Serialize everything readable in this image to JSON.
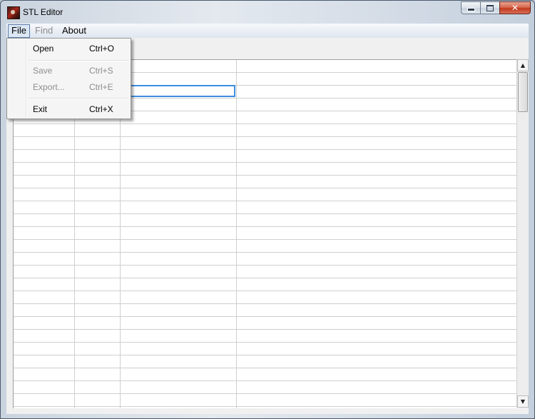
{
  "window": {
    "title": "STL Editor",
    "minimize_symbol": "",
    "maximize_symbol": "",
    "close_symbol": "✕"
  },
  "menubar": {
    "file": "File",
    "find": "Find",
    "about": "About"
  },
  "file_menu": {
    "items": [
      {
        "label": "Open",
        "shortcut": "Ctrl+O",
        "enabled": true
      },
      {
        "label": "Save",
        "shortcut": "Ctrl+S",
        "enabled": false
      },
      {
        "label": "Export...",
        "shortcut": "Ctrl+E",
        "enabled": false
      },
      {
        "label": "Exit",
        "shortcut": "Ctrl+X",
        "enabled": true
      }
    ]
  },
  "scrollbar": {
    "up_arrow": "▲",
    "down_arrow": "▼"
  },
  "colors": {
    "selection_border": "#3e8fe0",
    "grid_line": "#cfcfcf",
    "close_button": "#c2391c"
  }
}
